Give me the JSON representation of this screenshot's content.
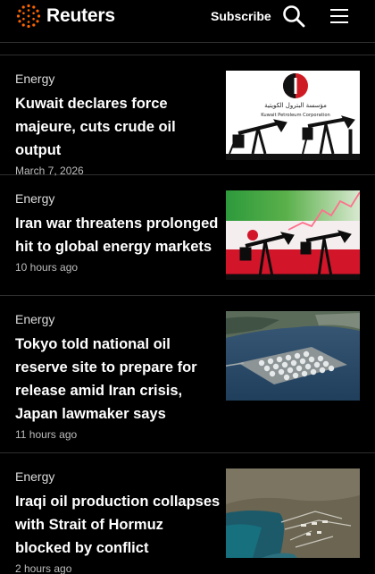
{
  "header": {
    "brand": "Reuters",
    "subscribe_label": "Subscribe",
    "logo_icon": "reuters-dot-ring-logo",
    "search_icon": "search-icon",
    "menu_icon": "hamburger-menu-icon",
    "accent_color": "#fa6400"
  },
  "stories": [
    {
      "category": "Energy",
      "headline": "Kuwait declares force majeure, cuts crude oil output",
      "time": "March 7, 2026",
      "image_logo_arabic": "مؤسسة البترول الكويتية",
      "image_logo_english": "Kuwait Petroleum Corporation"
    },
    {
      "category": "Energy",
      "headline": "Iran war threatens prolonged hit to global energy markets",
      "time": "10 hours ago"
    },
    {
      "category": "Energy",
      "headline": "Tokyo told national oil reserve site to prepare for release amid Iran crisis, Japan lawmaker says",
      "time": "11 hours ago"
    },
    {
      "category": "Energy",
      "headline": "Iraqi oil production collapses with Strait of Hormuz blocked by conflict",
      "time": "2 hours ago"
    }
  ]
}
